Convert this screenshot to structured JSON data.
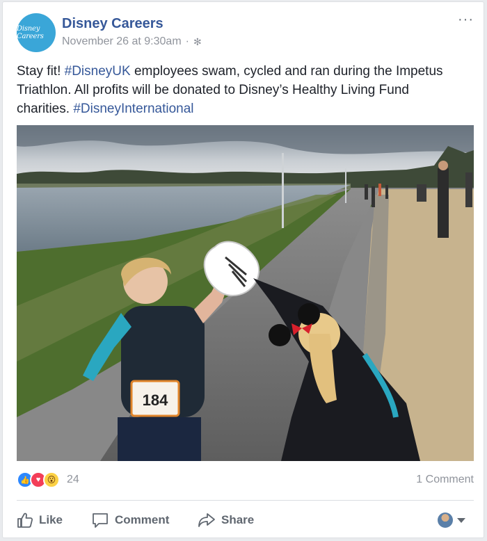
{
  "post": {
    "author": "Disney Careers",
    "avatar_text": "Disney Careers",
    "timestamp": "November 26 at 9:30am",
    "separator": "·",
    "options_label": "···",
    "text_parts": [
      "Stay fit! ",
      "#DisneyUK",
      " employees swam, cycled and ran during the Impetus Triathlon. All profits will be donated to Disney’s Healthy Living Fund charities. ",
      "#DisneyInternational"
    ],
    "photo_bib": "184"
  },
  "reactions": {
    "count": "24",
    "types": [
      "like",
      "love",
      "wow"
    ],
    "comments_label": "1 Comment"
  },
  "actions": {
    "like": "Like",
    "comment": "Comment",
    "share": "Share"
  },
  "colors": {
    "link": "#365899",
    "meta": "#90949c",
    "action": "#606770"
  }
}
